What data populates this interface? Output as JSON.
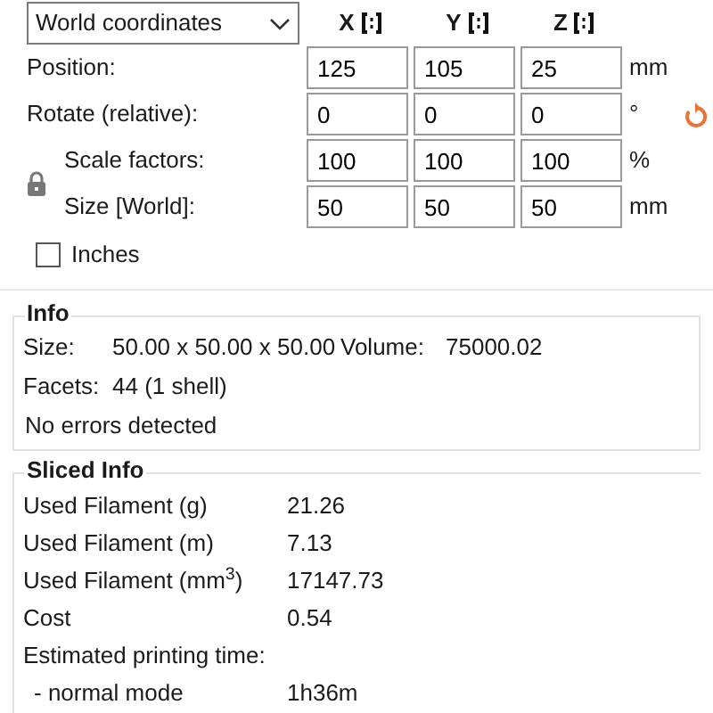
{
  "coordinates_dropdown": {
    "value": "World coordinates"
  },
  "axes": [
    {
      "label": "X"
    },
    {
      "label": "Y"
    },
    {
      "label": "Z"
    }
  ],
  "rows": [
    {
      "label": "Position:",
      "values": [
        "125",
        "105",
        "25"
      ],
      "unit": "mm",
      "reset": false
    },
    {
      "label": "Rotate (relative):",
      "values": [
        "0",
        "0",
        "0"
      ],
      "unit": "°",
      "reset": true
    }
  ],
  "scale_group": {
    "locked": true,
    "rows": [
      {
        "label": "Scale factors:",
        "values": [
          "100",
          "100",
          "100"
        ],
        "unit": "%"
      },
      {
        "label": "Size [World]:",
        "values": [
          "50",
          "50",
          "50"
        ],
        "unit": "mm"
      }
    ]
  },
  "inches": {
    "label": "Inches",
    "checked": false
  },
  "info": {
    "title": "Info",
    "size_label": "Size:",
    "size": "50.00 x 50.00 x 50.00",
    "volume_label": "Volume:",
    "volume": "75000.02",
    "facets_label": "Facets:",
    "facets": "44 (1 shell)",
    "status": "No errors detected"
  },
  "sliced_info": {
    "title": "Sliced Info",
    "rows": [
      {
        "label": "Used Filament (g)",
        "value": "21.26"
      },
      {
        "label": "Used Filament (m)",
        "value": "7.13"
      },
      {
        "label": "Used Filament (mm$^{3}$)",
        "value": "17147.73"
      },
      {
        "label": "Cost",
        "value": "0.54"
      },
      {
        "label": "Estimated printing time:"
      },
      {
        "label": "- normal mode",
        "value": "1h36m"
      }
    ]
  }
}
